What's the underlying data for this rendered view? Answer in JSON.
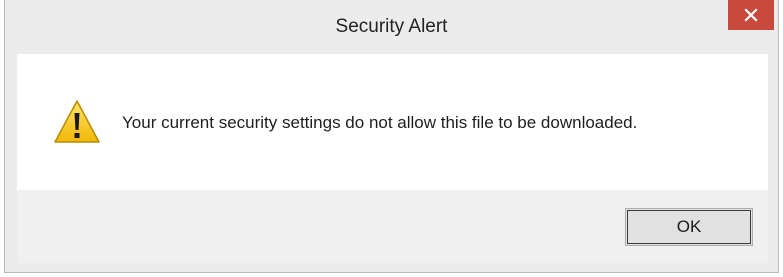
{
  "window": {
    "title": "Security Alert",
    "close_icon": "close-icon"
  },
  "dialog": {
    "icon": "warning-icon",
    "message": "Your current security settings do not allow this file to be downloaded.",
    "ok_label": "OK"
  },
  "colors": {
    "close_button": "#c74a3d",
    "content_background": "#ffffff",
    "footer_background": "#f0f0f0",
    "warning_fill": "#f5c518"
  }
}
